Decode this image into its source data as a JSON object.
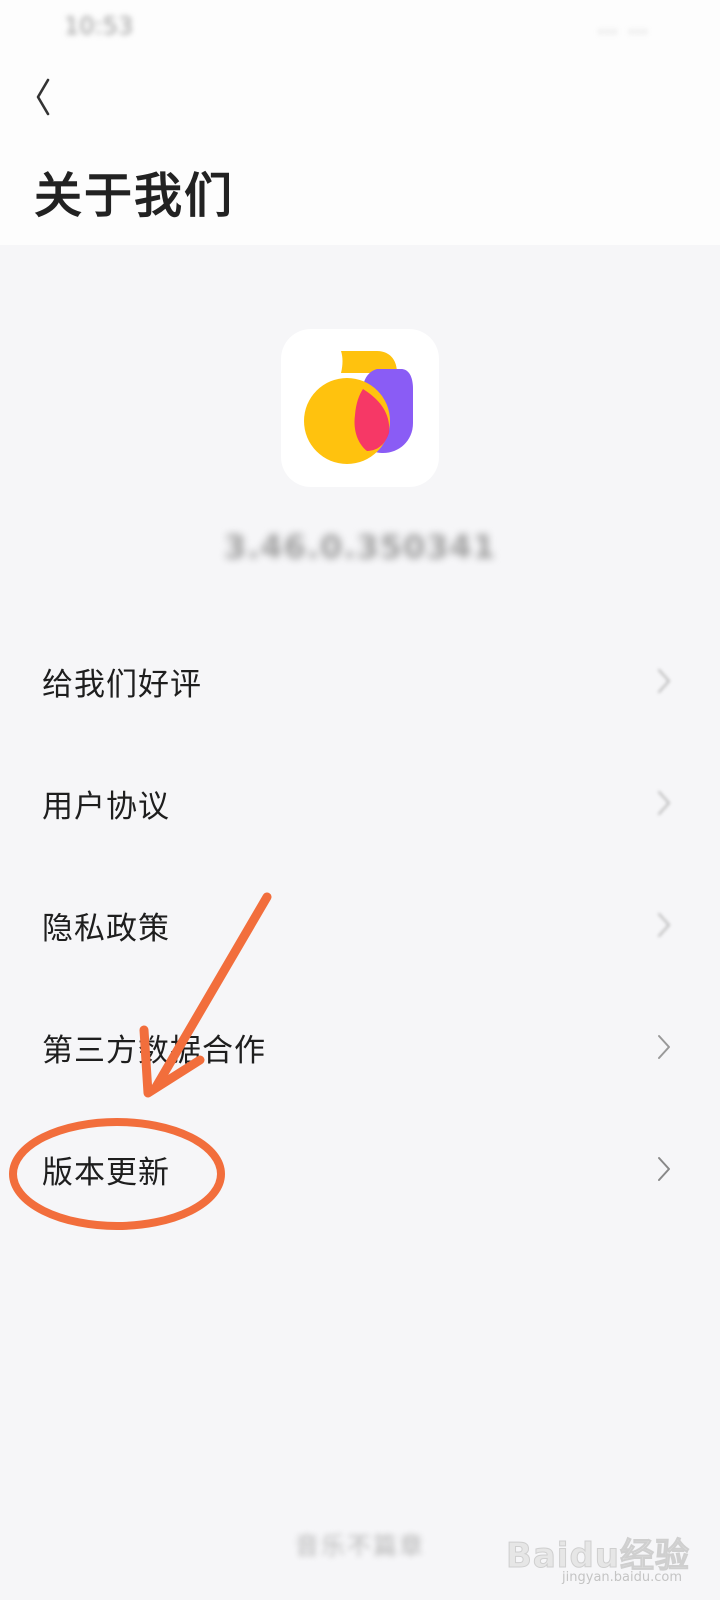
{
  "status_bar": {
    "time": "10:53",
    "icons": "… …"
  },
  "header": {
    "back_icon": "chevron-left-icon",
    "title": "关于我们"
  },
  "app": {
    "logo_icon": "app-logo-icon",
    "version": "3.46.0.350341"
  },
  "menu": {
    "items": [
      {
        "label": "给我们好评",
        "icon": "chevron-right-icon"
      },
      {
        "label": "用户协议",
        "icon": "chevron-right-icon"
      },
      {
        "label": "隐私政策",
        "icon": "chevron-right-icon"
      },
      {
        "label": "第三方数据合作",
        "icon": "chevron-right-icon"
      },
      {
        "label": "版本更新",
        "icon": "chevron-right-icon"
      }
    ]
  },
  "annotation": {
    "color": "#f26e3c",
    "highlighted_item": "版本更新"
  },
  "footer": {
    "text": "音乐不篇章"
  },
  "watermark": {
    "main": "Baidu经验",
    "sub": "jingyan.baidu.com"
  }
}
